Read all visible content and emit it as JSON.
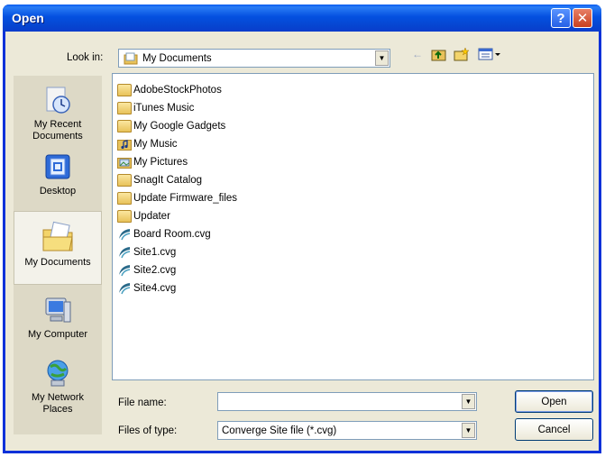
{
  "window": {
    "title": "Open"
  },
  "toolbar": {
    "look_in_label": "Look in:",
    "look_in_value": "My Documents",
    "icons": [
      "back-arrow-icon",
      "up-folder-icon",
      "new-folder-icon",
      "views-menu-icon"
    ]
  },
  "places": [
    {
      "label_line1": "My Recent",
      "label_line2": "Documents",
      "icon": "recent-documents-icon"
    },
    {
      "label_line1": "Desktop",
      "label_line2": "",
      "icon": "desktop-icon"
    },
    {
      "label_line1": "My Documents",
      "label_line2": "",
      "icon": "my-documents-icon"
    },
    {
      "label_line1": "My Computer",
      "label_line2": "",
      "icon": "my-computer-icon"
    },
    {
      "label_line1": "My Network",
      "label_line2": "Places",
      "icon": "network-places-icon"
    }
  ],
  "files": [
    {
      "name": "AdobeStockPhotos",
      "type": "folder"
    },
    {
      "name": "iTunes Music",
      "type": "folder"
    },
    {
      "name": "My Google Gadgets",
      "type": "folder"
    },
    {
      "name": "My Music",
      "type": "folder"
    },
    {
      "name": "My Pictures",
      "type": "folder"
    },
    {
      "name": "SnagIt Catalog",
      "type": "folder"
    },
    {
      "name": "Update Firmware_files",
      "type": "folder"
    },
    {
      "name": "Updater",
      "type": "folder"
    },
    {
      "name": "Board Room.cvg",
      "type": "cvg"
    },
    {
      "name": "Site1.cvg",
      "type": "cvg"
    },
    {
      "name": "Site2.cvg",
      "type": "cvg"
    },
    {
      "name": "Site4.cvg",
      "type": "cvg"
    }
  ],
  "footer": {
    "file_name_label": "File name:",
    "file_name_value": "",
    "file_type_label": "Files of type:",
    "file_type_value": "Converge Site file (*.cvg)",
    "open_label": "Open",
    "cancel_label": "Cancel"
  },
  "colors": {
    "titlebar": "#0450e0",
    "dialog_bg": "#ece9d8",
    "folder": "#e8c25a",
    "accent": "#0831d9"
  }
}
